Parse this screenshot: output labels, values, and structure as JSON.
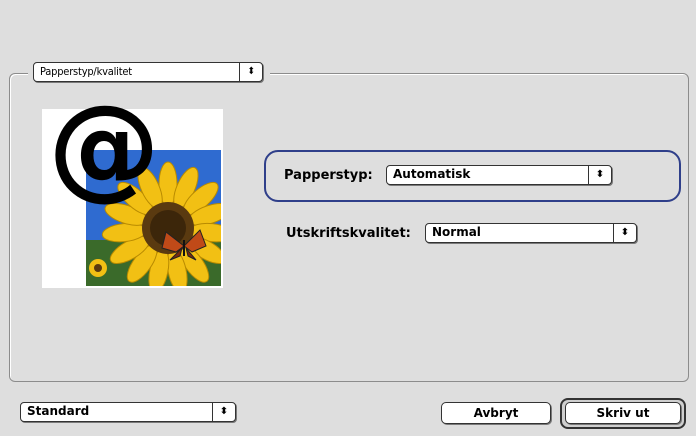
{
  "panel_selector": {
    "value": "Papperstyp/kvalitet"
  },
  "paper_type": {
    "label": "Papperstyp:",
    "value": "Automatisk"
  },
  "print_quality": {
    "label": "Utskriftskvalitet:",
    "value": "Normal"
  },
  "presets": {
    "value": "Standard"
  },
  "buttons": {
    "cancel": "Avbryt",
    "print": "Skriv ut"
  },
  "preview": {
    "symbol": "@"
  },
  "colors": {
    "background": "#dedede",
    "highlight": "#2f3f8a",
    "photo_sky": "#2f6bd0",
    "sunflower": "#f2c014"
  },
  "icons": {
    "popup_arrows": "updown-arrows-icon"
  }
}
